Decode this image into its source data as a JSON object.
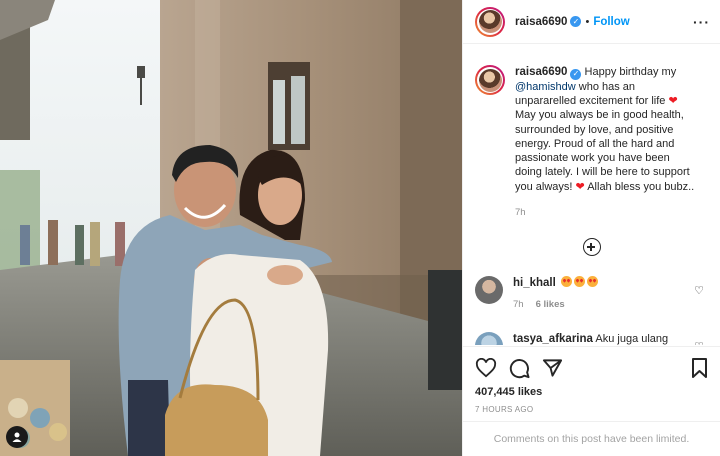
{
  "post": {
    "username": "raisa6690",
    "verified": true,
    "follow_label": "Follow",
    "separator": "•",
    "more_icon": "···"
  },
  "caption": {
    "username": "raisa6690",
    "text_1": "Happy birthday my",
    "mention": "@hamishdw",
    "text_2": "who has an unpararelled excitement for life",
    "text_3": "May you always be in good health, surrounded by love, and positive energy. Proud of all the hard and passionate work you have been doing lately. I will be here to support you always!",
    "text_4": "Allah bless you bubz..",
    "time": "7h"
  },
  "comments": [
    {
      "username": "hi_khall",
      "text": "",
      "emoji_count": 3,
      "time": "7h",
      "likes": "6 likes"
    },
    {
      "username": "tasya_afkarina",
      "text": "Aku juga ulang",
      "time": "",
      "likes": ""
    }
  ],
  "likes_text": "407,445 likes",
  "posted_time": "7 HOURS AGO",
  "comments_limited": "Comments on this post have been limited.",
  "icons": [
    "heart-icon",
    "comment-icon",
    "share-icon",
    "bookmark-icon",
    "more-icon",
    "plus-circle-icon",
    "verified-icon"
  ],
  "colors": {
    "accent": "#0095f6",
    "verified": "#3897f0",
    "muted": "#8e8e8e",
    "heart": "#ed1c24"
  }
}
